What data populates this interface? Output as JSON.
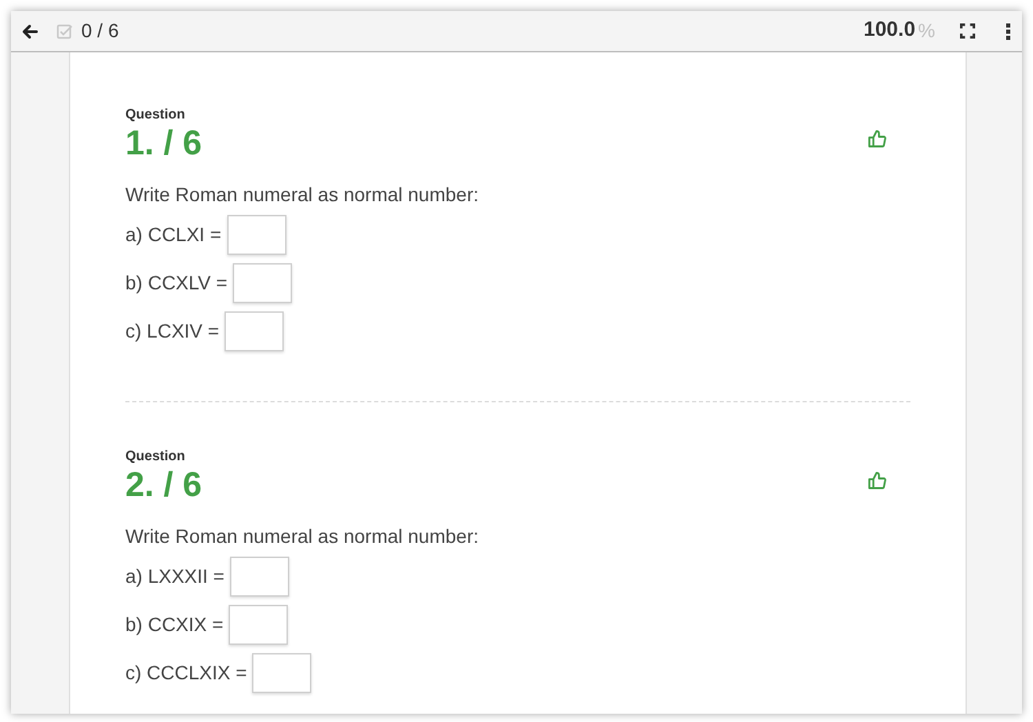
{
  "toolbar": {
    "progress": "0 / 6",
    "zoom": "100.0",
    "zoom_unit": "%"
  },
  "questions": [
    {
      "label": "Question",
      "number": "1. / 6",
      "prompt": "Write Roman numeral as normal number:",
      "items": [
        {
          "label": "a) CCLXI ="
        },
        {
          "label": "b) CCXLV ="
        },
        {
          "label": "c) LCXIV ="
        }
      ]
    },
    {
      "label": "Question",
      "number": "2. / 6",
      "prompt": "Write Roman numeral as normal number:",
      "items": [
        {
          "label": "a) LXXXII ="
        },
        {
          "label": "b) CCXIX ="
        },
        {
          "label": "c) CCCLXIX ="
        }
      ]
    }
  ]
}
